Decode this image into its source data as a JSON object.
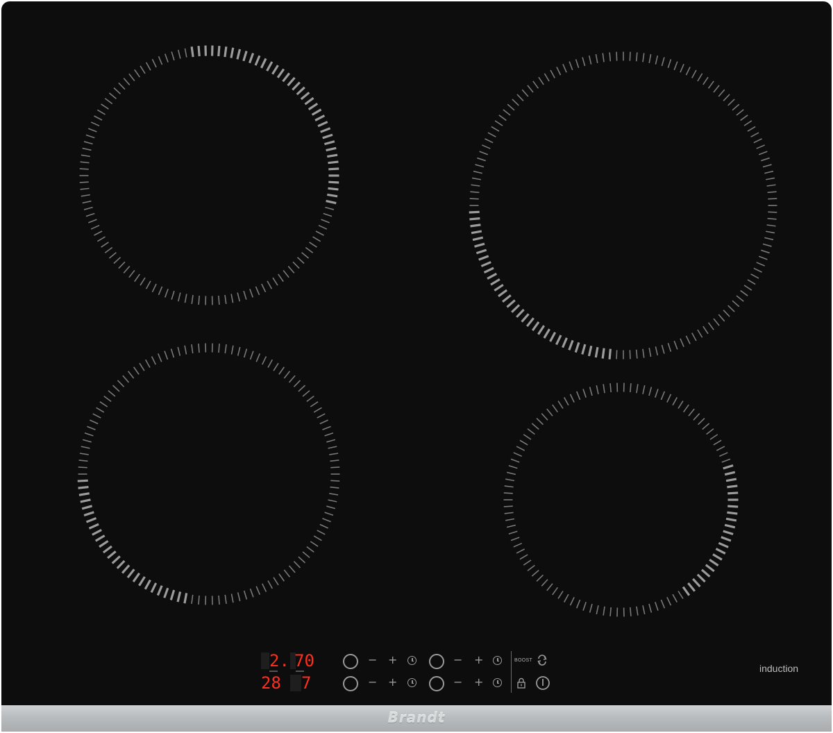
{
  "product": {
    "brand": "Brandt",
    "type_label": "induction"
  },
  "displays": {
    "top_left": "2.",
    "top_right": "70",
    "bottom_left": "28",
    "bottom_right": "7"
  },
  "controls": {
    "minus": "−",
    "plus": "+",
    "boost_label": "BOOST"
  },
  "colors": {
    "glass": "#0d0d0d",
    "ring_marks": "#8a8a8a",
    "display_red": "#ff2e1f",
    "trim": "#b9bcbf"
  },
  "icons": [
    "ring-button-icon",
    "minus-icon",
    "plus-icon",
    "timer-icon",
    "boost-cycle-icon",
    "lock-icon",
    "power-icon"
  ]
}
